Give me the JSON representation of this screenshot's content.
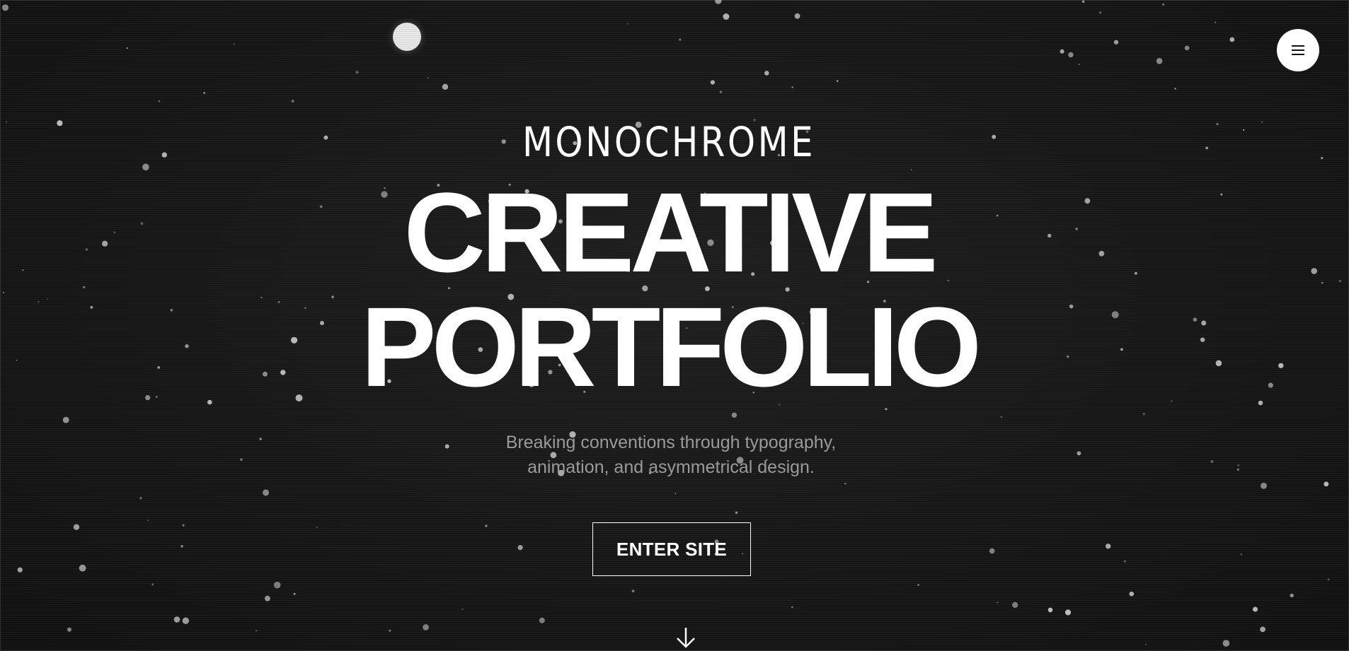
{
  "hero": {
    "eyebrow": "MONOCHROME",
    "headline_line1": "CREATIVE",
    "headline_line2": "PORTFOLIO",
    "tagline_line1": "Breaking conventions through typography,",
    "tagline_line2": "animation, and asymmetrical design.",
    "cta_label": "ENTER SITE"
  },
  "header": {
    "menu_icon": "hamburger-menu-icon"
  },
  "decor": {
    "moon_icon": "moon-icon",
    "scroll_icon": "arrow-down-icon"
  },
  "colors": {
    "background": "#141414",
    "text_primary": "#ffffff",
    "text_secondary": "#9a9a9a",
    "star": "#d0d0d0"
  }
}
